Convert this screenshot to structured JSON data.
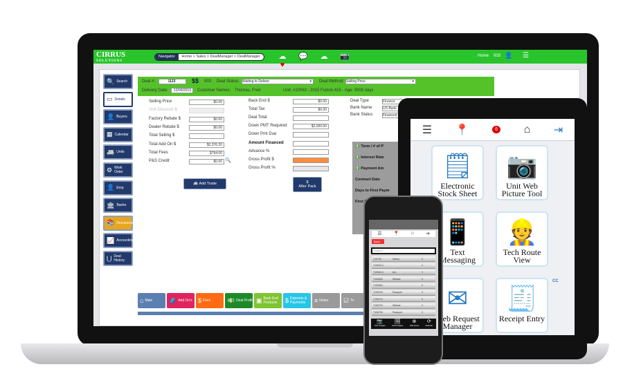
{
  "header": {
    "brand": "CIRRUS",
    "brand_sub": "SOLUTIONS",
    "nav_label": "Navigator",
    "breadcrumb": "Home > Sales > DealManager > DealManager",
    "home": "Home",
    "user": "003",
    "icons": [
      "cloud-heart-icon",
      "chat-search-icon",
      "cloud-search-icon",
      "screen-shot-icon"
    ]
  },
  "sidebar": [
    {
      "label": "Search",
      "icon": "search-icon"
    },
    {
      "label": "Details",
      "icon": "details-icon"
    },
    {
      "label": "Buyers",
      "icon": "buyers-icon"
    },
    {
      "label": "Calendar",
      "icon": "calendar-icon"
    },
    {
      "label": "Units",
      "icon": "rv-icon"
    },
    {
      "label": "Work Order",
      "icon": "work-order-icon"
    },
    {
      "label": "Emp",
      "icon": "employee-icon"
    },
    {
      "label": "Banks",
      "icon": "bank-icon"
    },
    {
      "label": "Documents",
      "icon": "documents-icon"
    },
    {
      "label": "Accounting",
      "icon": "accounting-icon"
    },
    {
      "label": "Deal History",
      "icon": "deal-history-icon"
    }
  ],
  "deal": {
    "deal_label": "Deal #:",
    "deal_no": "1123",
    "salesperson": "003",
    "status_label": "Deal Status:",
    "status": "Waiting to Deliver",
    "method_label": "Deal Method:",
    "method": "Selling Price",
    "delivery_label": "Delivery Date:",
    "delivery": "12/09/2019",
    "customer_label": "Customer Names:",
    "customer": "Thomas, Fred",
    "unit_label": "Unit:",
    "unit": "#10063 : 2015 Fuzion 416 - Age: 3009 days"
  },
  "left_fields": [
    {
      "label": "Selling Price",
      "value": "$0.00"
    },
    {
      "label": "Unit Discount $",
      "value": ""
    },
    {
      "label": "Factory Rebate $",
      "value": "$0.00"
    },
    {
      "label": "Dealer Rebate $",
      "value": "$0.00"
    },
    {
      "label": "Total Selling $",
      "value": ""
    },
    {
      "label": "Total Add On $",
      "value": "$2,376.20"
    },
    {
      "label": "Total Fees",
      "value": "$794.00"
    },
    {
      "label": "P&S Credit",
      "value": "$0.00"
    }
  ],
  "mid_fields": [
    {
      "label": "Back End $",
      "value": "$0.00"
    },
    {
      "label": "Total Tax",
      "value": "$0.00"
    },
    {
      "label": "Deal Total",
      "value": ""
    },
    {
      "label": "Down PMT Required",
      "value": "$2,000.00"
    },
    {
      "label": "Down Pmt Due",
      "value": ""
    },
    {
      "label": "Amount Financed",
      "value": ""
    },
    {
      "label": "Advance %",
      "value": ""
    },
    {
      "label": "Gross Profit $",
      "value": ""
    },
    {
      "label": "Gross Profit %",
      "value": ""
    }
  ],
  "right_fields": [
    {
      "label": "Deal Type",
      "value": "Finance"
    },
    {
      "label": "Bank Name",
      "value": "US Bank"
    },
    {
      "label": "Bank Status",
      "value": "Financed"
    }
  ],
  "finance_panel": [
    "Term / # of P",
    "Interest Rate",
    "Payment Am",
    "Contract Date",
    "Days to First Paym",
    "First Payment Date"
  ],
  "buttons": {
    "add_trade": "Add Trade",
    "after_pack": "After Pack"
  },
  "tabs": [
    {
      "label": "Main",
      "color": "#5b7fb0"
    },
    {
      "label": "Add On's",
      "color": "#e0245e"
    },
    {
      "label": "Fees",
      "color": "#ff6a13"
    },
    {
      "label": "Deal Profit",
      "color": "#1d8a2a"
    },
    {
      "label": "Back End Products",
      "color": "#7fc431"
    },
    {
      "label": "Deposits & Payments",
      "color": "#27c6e6"
    },
    {
      "label": "Notes",
      "color": "#9a9a9a"
    },
    {
      "label": "To",
      "color": "#9a9a9a"
    }
  ],
  "tablet": {
    "badge": "6",
    "tiles": [
      {
        "label": "Electronic Stock Sheet",
        "icon": "stock-sheet-icon"
      },
      {
        "label": "Unit Web Picture Tool",
        "icon": "camera-icon"
      },
      {
        "label": "Text Messaging",
        "icon": "phone-message-icon"
      },
      {
        "label": "Tech Route View",
        "icon": "technician-icon"
      },
      {
        "label": "Web Request Manager",
        "icon": "web-request-icon"
      },
      {
        "label": "Receipt Entry",
        "icon": "receipt-icon"
      }
    ],
    "receipt_text": "CC"
  },
  "phone": {
    "back": "Back",
    "search_placeholder": "Search ...",
    "rows": [
      [
        "T10730",
        "Select",
        "0"
      ],
      [
        "T10034-C",
        "",
        "0"
      ],
      [
        "T10063-C",
        "ALL",
        "0"
      ],
      [
        "T10063C",
        "Wildcat",
        "0"
      ],
      [
        "T10096C",
        "",
        "0"
      ],
      [
        "T10670C",
        "Passport",
        "0"
      ],
      [
        "T10671C",
        "",
        "0"
      ],
      [
        "T10670C",
        "Wildcat",
        "0"
      ],
      [
        "T10675C",
        "Passport",
        "0"
      ]
    ],
    "bottom": [
      "Unit Images",
      "Add Images",
      "Add Issue",
      "Refresh"
    ]
  },
  "colors": {
    "header_green": "#29c42c",
    "deal_green": "#55c22a",
    "navy": "#223a6b",
    "documents": "#e8a51e",
    "gross_profit": "#ff8c3a"
  }
}
